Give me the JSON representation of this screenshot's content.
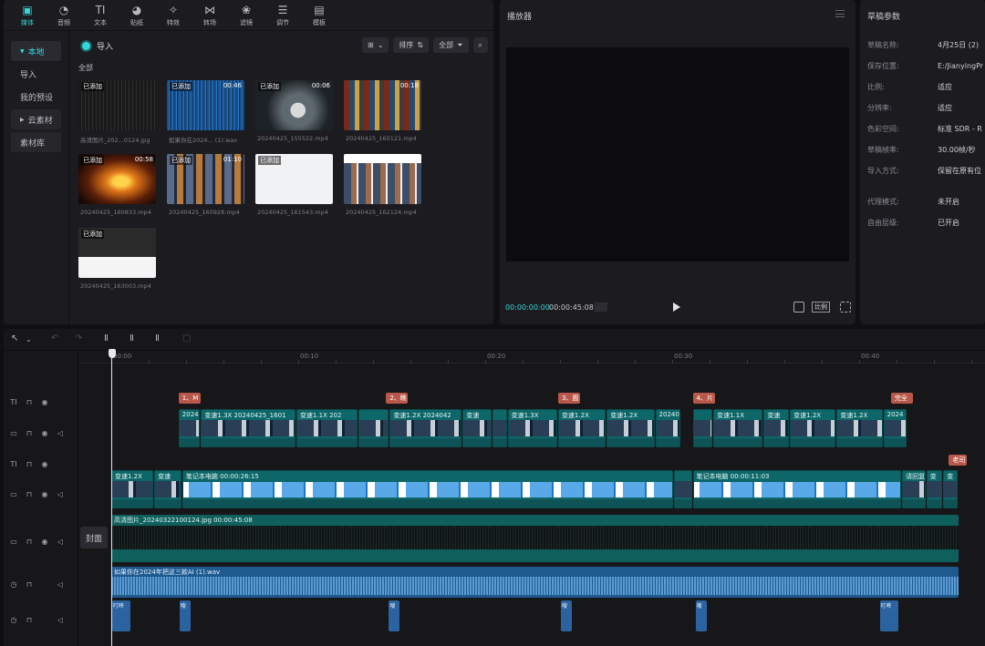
{
  "toolbar": [
    {
      "label": "媒体",
      "icon": "media-icon",
      "glyph": "▣",
      "active": true
    },
    {
      "label": "音频",
      "icon": "audio-icon",
      "glyph": "◔"
    },
    {
      "label": "文本",
      "icon": "text-icon",
      "glyph": "TI"
    },
    {
      "label": "贴纸",
      "icon": "sticker-icon",
      "glyph": "◕"
    },
    {
      "label": "特效",
      "icon": "effects-icon",
      "glyph": "✧"
    },
    {
      "label": "转场",
      "icon": "transition-icon",
      "glyph": "⋈"
    },
    {
      "label": "滤镜",
      "icon": "filter-icon",
      "glyph": "❀"
    },
    {
      "label": "调节",
      "icon": "adjust-icon",
      "glyph": "☰"
    },
    {
      "label": "模板",
      "icon": "template-icon",
      "glyph": "▤"
    }
  ],
  "sidebar": [
    {
      "label": "本地",
      "selected": true,
      "arrow": "▼"
    },
    {
      "label": "导入"
    },
    {
      "label": "我的预设"
    },
    {
      "label": "云素材",
      "arrow": "▶",
      "group": true
    },
    {
      "label": "素材库",
      "group": true
    }
  ],
  "media": {
    "import_label": "导入",
    "sort_label": "排序",
    "filter_label": "全部",
    "section_label": "全部",
    "items": [
      {
        "badge": "已添加",
        "duration": "",
        "name": "高清图片_202...0124.jpg",
        "thumb": "t-dark"
      },
      {
        "badge": "已添加",
        "duration": "00:46",
        "name": "如果你在2024... (1).wav",
        "thumb": "t-wave"
      },
      {
        "badge": "已添加",
        "duration": "00:06",
        "name": "20240425_155522.mp4",
        "thumb": "t-photo"
      },
      {
        "badge": "",
        "duration": "00:18",
        "name": "20240425_160121.mp4",
        "thumb": "t-posters"
      },
      {
        "badge": "已添加",
        "duration": "00:58",
        "name": "20240425_160833.mp4",
        "thumb": "t-fire"
      },
      {
        "badge": "已添加",
        "duration": "01:10",
        "name": "20240425_160928.mp4",
        "thumb": "t-grid2"
      },
      {
        "badge": "已添加",
        "duration": "",
        "name": "20240425_161543.mp4",
        "thumb": "t-white"
      },
      {
        "badge": "",
        "duration": "",
        "name": "20240425_162124.mp4",
        "thumb": "t-wposters"
      },
      {
        "badge": "已添加",
        "duration": "",
        "name": "20240425_163003.mp4",
        "thumb": "t-people"
      }
    ]
  },
  "player": {
    "title": "播放器",
    "current_time": "00:00:00:00",
    "total_time": "00:00:45:08",
    "ratio_label": "比例"
  },
  "params": {
    "title": "草稿参数",
    "rows": [
      {
        "k": "草稿名称:",
        "v": "4月25日 (2)"
      },
      {
        "k": "保存位置:",
        "v": "E:/JianyingPr"
      },
      {
        "k": "比例:",
        "v": "适应"
      },
      {
        "k": "分辨率:",
        "v": "适应"
      },
      {
        "k": "色彩空间:",
        "v": "标准 SDR - R"
      },
      {
        "k": "草稿帧率:",
        "v": "30.00帧/秒"
      },
      {
        "k": "导入方式:",
        "v": "保留在原有位"
      },
      {
        "k": "代理模式:",
        "v": "未开启"
      },
      {
        "k": "自由层级:",
        "v": "已开启"
      }
    ]
  },
  "timeline": {
    "ruler": [
      {
        "label": "00:00",
        "t": 0
      },
      {
        "label": "00:10",
        "t": 10
      },
      {
        "label": "00:20",
        "t": 20
      },
      {
        "label": "00:30",
        "t": 30
      },
      {
        "label": "00:40",
        "t": 40
      }
    ],
    "cover_label": "封面",
    "chips": [
      {
        "text": "1、M",
        "t": 3.6
      },
      {
        "text": "2、瞧",
        "t": 14.7
      },
      {
        "text": "3、圊",
        "t": 23.9
      },
      {
        "text": "4、片",
        "t": 31.1
      },
      {
        "text": "完全",
        "t": 41.7
      },
      {
        "text": "老司",
        "t": 44.8
      }
    ],
    "top_clips": [
      {
        "text": "20240",
        "t0": 3.6,
        "t1": 4.8
      },
      {
        "text": "变速1.3X   20240425_1601",
        "t0": 4.8,
        "t1": 9.9
      },
      {
        "text": "变速1.1X   202",
        "t0": 9.9,
        "t1": 13.2
      },
      {
        "text": "",
        "t0": 13.2,
        "t1": 14.9
      },
      {
        "text": "变速1.2X   2024042",
        "t0": 14.9,
        "t1": 18.8
      },
      {
        "text": "变速",
        "t0": 18.8,
        "t1": 20.4
      },
      {
        "text": "",
        "t0": 20.4,
        "t1": 21.2
      },
      {
        "text": "变速1.3X",
        "t0": 21.2,
        "t1": 23.9
      },
      {
        "text": "变速1.2X",
        "t0": 23.9,
        "t1": 26.5
      },
      {
        "text": "变速1.2X",
        "t0": 26.5,
        "t1": 29.1
      },
      {
        "text": "20240",
        "t0": 29.1,
        "t1": 30.5
      },
      {
        "text": "",
        "t0": 31.1,
        "t1": 32.2
      },
      {
        "text": "变速1.1X",
        "t0": 32.2,
        "t1": 34.9
      },
      {
        "text": "变速",
        "t0": 34.9,
        "t1": 36.3
      },
      {
        "text": "变速1.2X",
        "t0": 36.3,
        "t1": 38.8
      },
      {
        "text": "变速1.2X",
        "t0": 38.8,
        "t1": 41.3
      },
      {
        "text": "2024",
        "t0": 41.3,
        "t1": 42.6
      }
    ],
    "main_clips": [
      {
        "text": "变速1.2X",
        "t0": 0,
        "t1": 2.3
      },
      {
        "text": "变速",
        "t0": 2.3,
        "t1": 3.8
      },
      {
        "text": "笔记本电脑   00:00:26:15",
        "t0": 3.8,
        "t1": 30.1,
        "main": true
      },
      {
        "text": "",
        "t0": 30.1,
        "t1": 31.1
      },
      {
        "text": "笔记本电脑   00:00:11:03",
        "t0": 31.1,
        "t1": 42.3,
        "main": true
      },
      {
        "text": "请回复",
        "t0": 42.3,
        "t1": 43.6
      },
      {
        "text": "变",
        "t0": 43.6,
        "t1": 44.5
      },
      {
        "text": "变",
        "t0": 44.5,
        "t1": 45.3
      }
    ],
    "image_clip": {
      "text": "高清图片_20240322100124.jpg   00:00:45:08",
      "t0": 0,
      "t1": 45.3
    },
    "audio_clip": {
      "text": "如果你在2024年把这三款AI (1).wav",
      "t0": 0,
      "t1": 45.3
    },
    "sfx": [
      {
        "text": "叮咚",
        "t": 0.05
      },
      {
        "text": "嗖",
        "t": 3.65
      },
      {
        "text": "嗖",
        "t": 14.85
      },
      {
        "text": "嗖",
        "t": 24.05
      },
      {
        "text": "嗖",
        "t": 31.25
      },
      {
        "text": "叮咚",
        "t": 41.1
      }
    ]
  }
}
